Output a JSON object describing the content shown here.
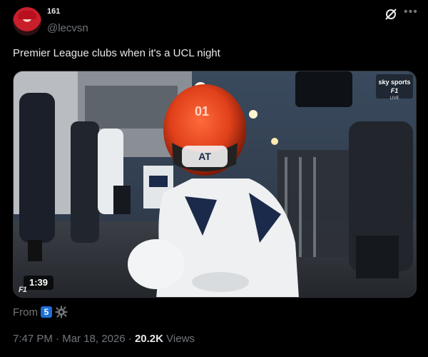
{
  "author": {
    "name": "161",
    "handle": "@lecvsn"
  },
  "tweet": {
    "text": "Premier League clubs when it's a UCL night"
  },
  "media": {
    "duration": "1:39",
    "watermark_text": "F1",
    "broadcaster": "sky sports",
    "broadcaster_sub": "F1",
    "live_label": "LIVE",
    "helmet_number": "01"
  },
  "source": {
    "label": "From",
    "badge": "5"
  },
  "meta": {
    "time": "7:47 PM",
    "sep1": "·",
    "date": "Mar 18, 2026",
    "sep2": "·",
    "views_count": "20.2K",
    "views_label": "Views"
  },
  "colors": {
    "background": "#000000",
    "text_primary": "#e7e9ea",
    "text_secondary": "#71767b",
    "badge_blue": "#1d6fd6"
  },
  "icons": [
    "grok-icon",
    "more-icon",
    "gear-icon",
    "avatar"
  ]
}
